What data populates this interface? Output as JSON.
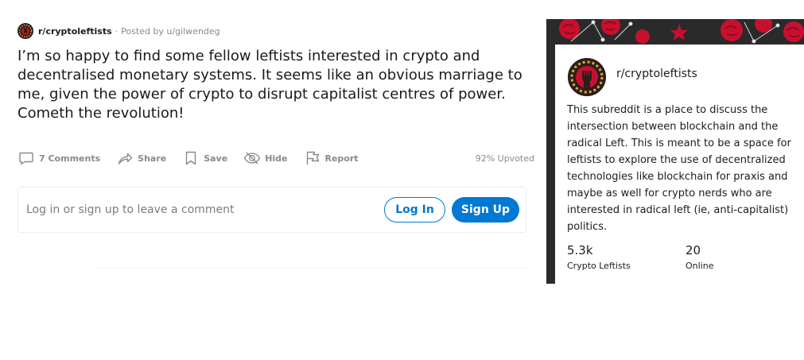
{
  "post": {
    "subreddit": "r/cryptoleftists",
    "separator": "·",
    "posted_by": "Posted by u/gilwendeg",
    "title": "I’m so happy to find some fellow leftists interested in crypto and decentralised monetary systems. It seems like an obvious marriage to me, given the power of crypto to disrupt capitalist centres of power. Cometh the revolution!",
    "actions": {
      "comments": "7 Comments",
      "share": "Share",
      "save": "Save",
      "hide": "Hide",
      "report": "Report"
    },
    "upvoted": "92% Upvoted"
  },
  "comment_box": {
    "prompt": "Log in or sign up to leave a comment",
    "login_label": "Log In",
    "signup_label": "Sign Up"
  },
  "sidebar": {
    "title": "r/cryptoleftists",
    "description": "This subreddit is a place to discuss the intersection between blockchain and the radical Left. This is meant to be a space for leftists to explore the use of decentralized technologies like blockchain for praxis and maybe as well for crypto nerds who are interested in radical left (ie, anti-capitalist) politics.",
    "members_count": "5.3k",
    "members_label": "Crypto Leftists",
    "online_count": "20",
    "online_label": "Online"
  },
  "colors": {
    "accent_blue": "#0079d3",
    "meta_gray": "#878a8c",
    "banner_red": "#c8102e",
    "banner_dark": "#2a2a2a"
  },
  "icons": {
    "comments": "comment-bubble-icon",
    "share": "share-arrow-icon",
    "save": "bookmark-icon",
    "hide": "eye-slash-icon",
    "report": "flag-icon"
  }
}
